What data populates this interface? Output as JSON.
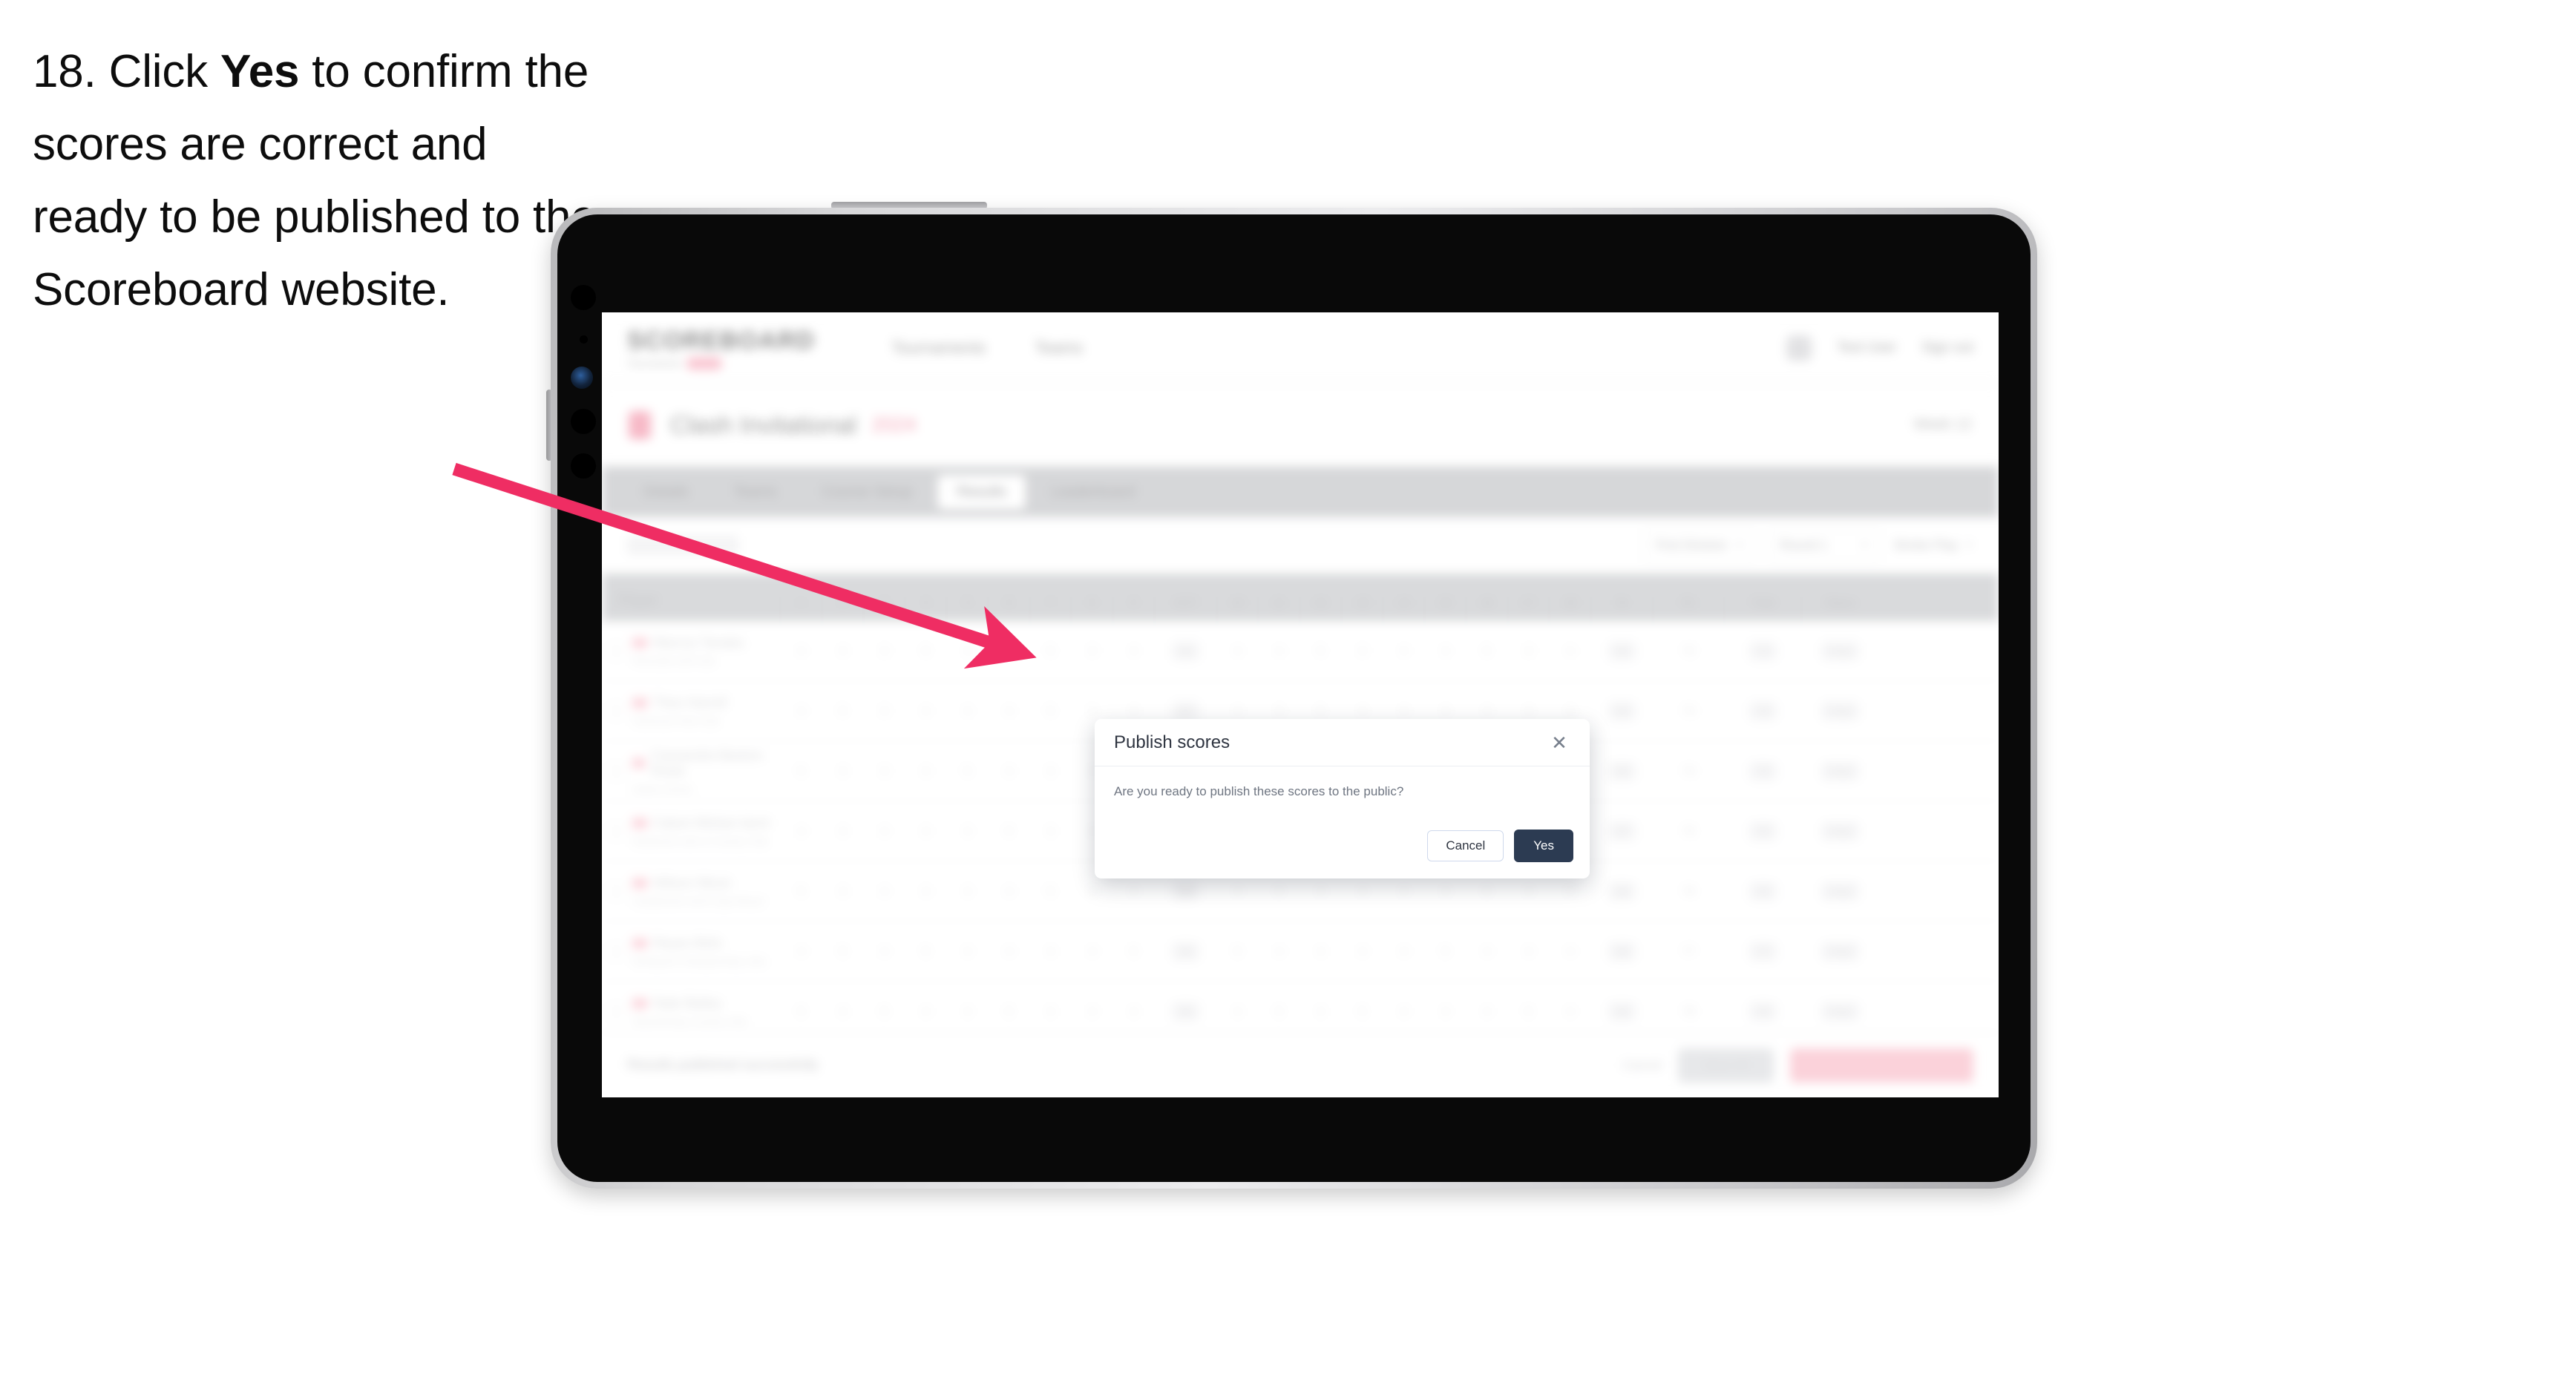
{
  "instruction": {
    "step_number": "18.",
    "text_before": "Click ",
    "emphasis": "Yes",
    "text_after": " to confirm the scores are correct and ready to be published to the Scoreboard website."
  },
  "colors": {
    "arrow": "#ef2d63",
    "primary_button": "#2c3b52",
    "dialog_border": "#cfd9ec",
    "brand_pink": "#f9c3cf"
  },
  "modal": {
    "title": "Publish scores",
    "message": "Are you ready to publish these scores to the public?",
    "close_icon": "close-icon",
    "buttons": {
      "cancel": "Cancel",
      "confirm": "Yes"
    }
  },
  "app": {
    "brand": {
      "word": "SCOREBOARD",
      "subtitle": "Tournament",
      "chip": "LIVE"
    },
    "topnav": [
      "Tournaments",
      "Teams"
    ],
    "header_right": {
      "user": "Test User",
      "signout": "Sign out",
      "avatar": "avatar"
    },
    "page_title": {
      "icon": "trophy-icon",
      "main": "Clash Invitational",
      "tag": "2024",
      "right": "Week 12"
    },
    "tabs": [
      {
        "label": "Details",
        "active": false
      },
      {
        "label": "Teams",
        "active": false
      },
      {
        "label": "Course Setup",
        "active": false
      },
      {
        "label": "Results",
        "active": true
      },
      {
        "label": "Leaderboard",
        "active": false
      }
    ],
    "toolbar": {
      "search_placeholder": "Search",
      "filters": [
        {
          "label": "First Division",
          "icon": "chevron-down-icon"
        },
        {
          "label": "Round 1",
          "icon": "chevron-down-icon"
        },
        {
          "label": "Stroke Play",
          "icon": "chevron-down-icon"
        }
      ]
    },
    "table": {
      "player_header": "Player",
      "hole_headers": [
        "1",
        "2",
        "3",
        "4",
        "5",
        "6",
        "7",
        "8",
        "9",
        "OUT",
        "10",
        "11",
        "12",
        "13",
        "14",
        "15",
        "16",
        "17",
        "18",
        "IN"
      ],
      "tail_headers": [
        "R1",
        "Total",
        "Status"
      ],
      "rows": [
        {
          "name": "Marcus Tanaka",
          "club": "Riverside Golf Club",
          "holes": [
            "4",
            "4",
            "3",
            "5",
            "4",
            "4",
            "5",
            "3",
            "4"
          ],
          "in": [
            "4",
            "4",
            "5",
            "3",
            "4",
            "4",
            "5",
            "3",
            "4"
          ],
          "out": "36",
          "inn": "36",
          "r1": "72",
          "total": "72",
          "status": "Final"
        },
        {
          "name": "Theo Harrell",
          "club": "Greenock Park Club",
          "holes": [
            "4",
            "5",
            "3",
            "4",
            "4",
            "4",
            "5",
            "4",
            "4"
          ],
          "in": [
            "4",
            "3",
            "5",
            "4",
            "4",
            "4",
            "4",
            "4",
            "4"
          ],
          "out": "37",
          "inn": "36",
          "r1": "73",
          "total": "73",
          "status": "Final"
        },
        {
          "name": "Cassandra Beeton-Rowe",
          "club": "Harbor Dunes",
          "holes": [
            "5",
            "4",
            "3",
            "4",
            "5",
            "4",
            "4",
            "4",
            "4"
          ],
          "in": [
            "4",
            "4",
            "4",
            "4",
            "5",
            "4",
            "4",
            "3",
            "4"
          ],
          "out": "37",
          "inn": "36",
          "r1": "73",
          "total": "73",
          "status": "Final"
        },
        {
          "name": "Calum Mohan-Ianni",
          "club": "Eastwood Links & Country Club",
          "holes": [
            "4",
            "4",
            "4",
            "4",
            "4",
            "5",
            "4",
            "4",
            "5"
          ],
          "in": [
            "4",
            "4",
            "4",
            "5",
            "4",
            "4",
            "4",
            "4",
            "4"
          ],
          "out": "38",
          "inn": "37",
          "r1": "75",
          "total": "75",
          "status": "Final"
        },
        {
          "name": "Wilson Nkosi",
          "club": "Castlebrook Golf & Spa Resort",
          "holes": [
            "5",
            "4",
            "4",
            "4",
            "4",
            "4",
            "5",
            "4",
            "4"
          ],
          "in": [
            "4",
            "5",
            "4",
            "4",
            "4",
            "4",
            "5",
            "4",
            "4"
          ],
          "out": "38",
          "inn": "38",
          "r1": "76",
          "total": "76",
          "status": "Final"
        },
        {
          "name": "Reyes Brito",
          "club": "Northpoint Championship Links",
          "holes": [
            "4",
            "5",
            "4",
            "5",
            "4",
            "4",
            "4",
            "4",
            "5"
          ],
          "in": [
            "5",
            "4",
            "4",
            "4",
            "4",
            "5",
            "4",
            "4",
            "4"
          ],
          "out": "39",
          "inn": "38",
          "r1": "77",
          "total": "77",
          "status": "Final"
        },
        {
          "name": "Nate Bailey",
          "club": "Silverhill Bay Country Club",
          "holes": [
            "5",
            "4",
            "5",
            "4",
            "4",
            "5",
            "4",
            "4",
            "4"
          ],
          "in": [
            "4",
            "5",
            "4",
            "5",
            "4",
            "4",
            "4",
            "5",
            "4"
          ],
          "out": "39",
          "inn": "39",
          "r1": "78",
          "total": "78",
          "status": "Final"
        }
      ]
    },
    "action_bar": {
      "note": "Results published successfully",
      "cancel_link": "Cancel",
      "secondary_button": "Save All",
      "primary_button": "Publish scores to public"
    }
  }
}
